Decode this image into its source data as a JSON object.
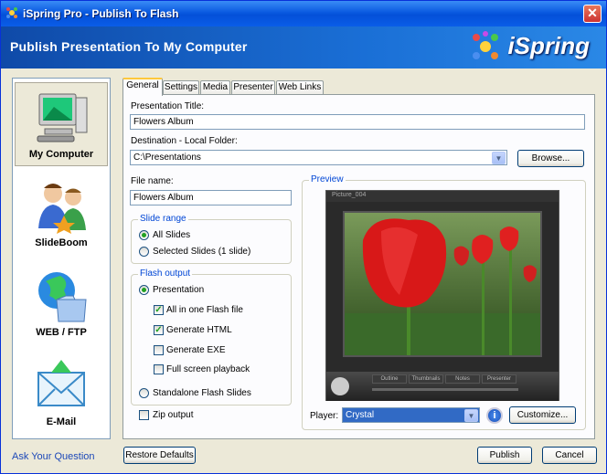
{
  "window": {
    "title": "iSpring Pro - Publish To Flash",
    "close_glyph": "✕"
  },
  "header": {
    "title": "Publish Presentation To My Computer",
    "logo": "iSpring"
  },
  "sidebar": {
    "items": [
      {
        "label": "My Computer"
      },
      {
        "label": "SlideBoom"
      },
      {
        "label": "WEB / FTP"
      },
      {
        "label": "E-Mail"
      }
    ]
  },
  "ask_link": "Ask Your Question",
  "tabs": [
    "General",
    "Settings",
    "Media",
    "Presenter",
    "Web Links"
  ],
  "general": {
    "presentation_title_label": "Presentation Title:",
    "presentation_title_value": "Flowers Album",
    "destination_label": "Destination - Local Folder:",
    "destination_value": "C:\\Presentations",
    "browse_label": "Browse...",
    "file_name_label": "File name:",
    "file_name_value": "Flowers Album",
    "slide_range": {
      "title": "Slide range",
      "all": "All Slides",
      "selected": "Selected Slides (1 slide)"
    },
    "flash_output": {
      "title": "Flash output",
      "presentation": "Presentation",
      "all_in_one": "All in one Flash file",
      "generate_html": "Generate HTML",
      "generate_exe": "Generate EXE",
      "full_screen": "Full screen playback",
      "standalone": "Standalone Flash Slides"
    },
    "zip_output": "Zip output",
    "preview": {
      "title": "Preview",
      "player_caption": "Picture_004",
      "ctrl_tabs": [
        "Outline",
        "Thumbnails",
        "Notes",
        "Presenter"
      ]
    },
    "player_label": "Player:",
    "player_value": "Crystal",
    "info_glyph": "i",
    "customize_label": "Customize..."
  },
  "footer": {
    "restore_label": "Restore Defaults",
    "publish_label": "Publish",
    "cancel_label": "Cancel"
  },
  "colors": {
    "accent": "#0a5ae0",
    "group_title": "#0046d5",
    "check": "#21a121"
  }
}
